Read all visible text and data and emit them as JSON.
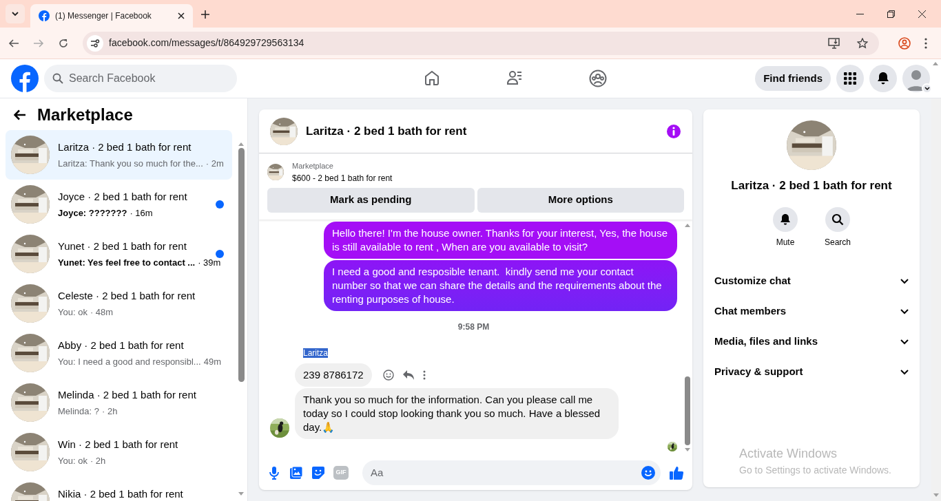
{
  "browser": {
    "tab_title": "(1) Messenger | Facebook",
    "url": "facebook.com/messages/t/864929729563134"
  },
  "header": {
    "search_placeholder": "Search Facebook",
    "find_friends": "Find friends"
  },
  "sidebar": {
    "title": "Marketplace",
    "conversations": [
      {
        "name": "Laritza · 2 bed 1 bath for rent",
        "preview": "Laritza: Thank you so much for the...",
        "time": "· 2m",
        "unread": false,
        "selected": true
      },
      {
        "name": "Joyce · 2 bed 1 bath for rent",
        "preview": "Joyce: ???????",
        "time": "· 16m",
        "unread": true,
        "selected": false
      },
      {
        "name": "Yunet · 2 bed 1 bath for rent",
        "preview": "Yunet: Yes feel free to contact ...",
        "time": "· 39m",
        "unread": true,
        "selected": false
      },
      {
        "name": "Celeste · 2 bed 1 bath for rent",
        "preview": "You: ok",
        "time": "· 48m",
        "unread": false,
        "selected": false
      },
      {
        "name": "Abby · 2 bed 1 bath for rent",
        "preview": "You: I need a good and responsibl...",
        "time": "49m",
        "unread": false,
        "selected": false
      },
      {
        "name": "Melinda · 2 bed 1 bath for rent",
        "preview": "Melinda: ?",
        "time": "· 2h",
        "unread": false,
        "selected": false
      },
      {
        "name": "Win · 2 bed 1 bath for rent",
        "preview": "You: ok",
        "time": "· 2h",
        "unread": false,
        "selected": false
      },
      {
        "name": "Nikia · 2 bed 1 bath for rent",
        "selected": false
      }
    ]
  },
  "chat": {
    "title": "Laritza · 2 bed 1 bath for rent",
    "listing": {
      "label": "Marketplace",
      "title": "$600 - 2 bed 1 bath for rent"
    },
    "buttons": [
      "Mark as pending",
      "More options"
    ],
    "messages": [
      {
        "kind": "outgoing",
        "text": "Hello there! I'm the house owner. Thanks for your interest, Yes, the house is still available to rent , When are you available to visit?"
      },
      {
        "kind": "outgoing",
        "text": "I need a good and resposible tenant.  kindly send me your contact number so that we can share the details and the requirements about the renting purposes of house."
      },
      {
        "kind": "timestamp",
        "text": "9:58 PM"
      },
      {
        "kind": "sender",
        "text": "Laritza",
        "highlighted": true
      },
      {
        "kind": "incoming",
        "text": "239 8786172",
        "actions": true
      },
      {
        "kind": "incoming",
        "text": "Thank you so much for the information. Can you please call me today so I could stop looking thank you so much. Have a blessed day.🙏",
        "avatar": true
      }
    ],
    "composer": {
      "gif_label": "GIF",
      "placeholder": "Aa"
    }
  },
  "details": {
    "title": "Laritza · 2 bed 1 bath for rent",
    "actions": [
      {
        "kind": "mute",
        "label": "Mute"
      },
      {
        "kind": "search",
        "label": "Search"
      }
    ],
    "sections": [
      {
        "label": "Customize chat",
        "expanded": false
      },
      {
        "label": "Chat members",
        "expanded": false
      },
      {
        "label": "Media, files and links",
        "expanded": false
      },
      {
        "label": "Privacy & support",
        "expanded": false
      }
    ]
  },
  "os_notice": {
    "title": "Activate Windows",
    "text": "Go to Settings to activate Windows."
  }
}
